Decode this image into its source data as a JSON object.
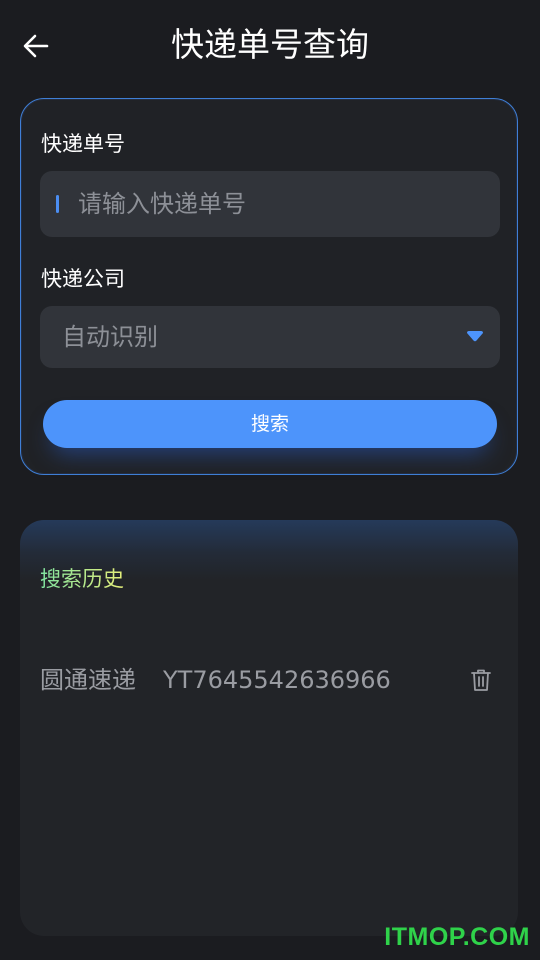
{
  "header": {
    "title": "快递单号查询",
    "back_icon": "arrow-left-icon"
  },
  "form": {
    "tracking_label": "快递单号",
    "tracking_placeholder": "请输入快递单号",
    "tracking_value": "",
    "company_label": "快递公司",
    "company_selected": "自动识别",
    "dropdown_icon": "caret-down-icon",
    "search_button": "搜索"
  },
  "history": {
    "title": "搜索历史",
    "items": [
      {
        "company": "圆通速递",
        "number": "YT7645542636966",
        "delete_icon": "trash-icon"
      }
    ]
  },
  "watermark": "ITMOP.COM",
  "colors": {
    "background": "#1b1c20",
    "card": "#202226",
    "input": "#31343a",
    "accent": "#4d94fb",
    "history_title_start": "#7fe3a0",
    "history_title_end": "#e6ef7a"
  }
}
